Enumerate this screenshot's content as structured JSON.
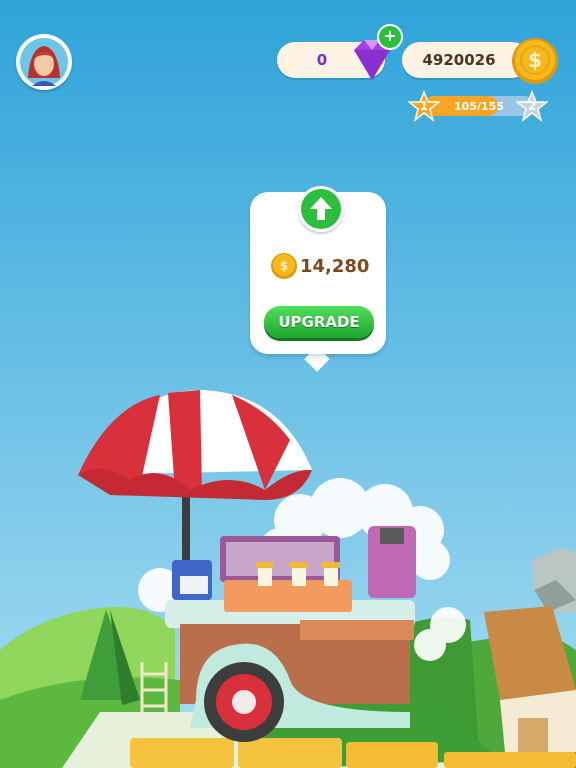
{
  "hud": {
    "gems": "0",
    "coins": "4920026",
    "level_current": "1",
    "level_next": "2",
    "xp_text": "105/155",
    "xp_fraction": 0.677
  },
  "popup": {
    "cost": "14,280",
    "upgrade_label": "UPGRADE"
  },
  "colors": {
    "sky_top": "#2ea3d9",
    "sky_bottom": "#9ad4ee",
    "grass": "#63c34a",
    "accent_green": "#2cbf3f",
    "coin_gold": "#f6b81b",
    "gem_purple": "#a43ee6",
    "umbrella_red": "#d9313b"
  },
  "icons": [
    "avatar-icon",
    "gem-icon",
    "plus-icon",
    "coin-icon",
    "star-icon",
    "arrow-up-icon"
  ]
}
